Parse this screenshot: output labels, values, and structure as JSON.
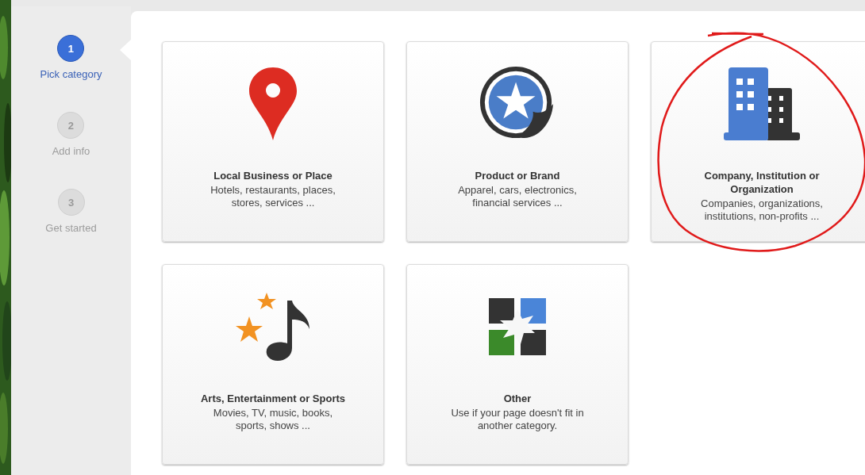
{
  "steps": [
    {
      "number": "1",
      "label": "Pick category",
      "selected": true
    },
    {
      "number": "2",
      "label": "Add info",
      "selected": false
    },
    {
      "number": "3",
      "label": "Get started",
      "selected": false
    }
  ],
  "categories": [
    {
      "kind": "pin",
      "title": "Local Business or Place",
      "description": "Hotels, restaurants, places, stores, services ...",
      "circled": false
    },
    {
      "kind": "sticker",
      "title": "Product or Brand",
      "description": "Apparel, cars, electronics, financial services ...",
      "circled": false
    },
    {
      "kind": "building",
      "title": "Company, Institution or Organization",
      "description": "Companies, organizations, institutions, non-profits ...",
      "circled": true
    },
    {
      "kind": "music",
      "title": "Arts, Entertainment or Sports",
      "description": "Movies, TV, music, books, sports, shows ...",
      "circled": false
    },
    {
      "kind": "puzzle",
      "title": "Other",
      "description": "Use if your page doesn't fit in another category.",
      "circled": false
    }
  ]
}
